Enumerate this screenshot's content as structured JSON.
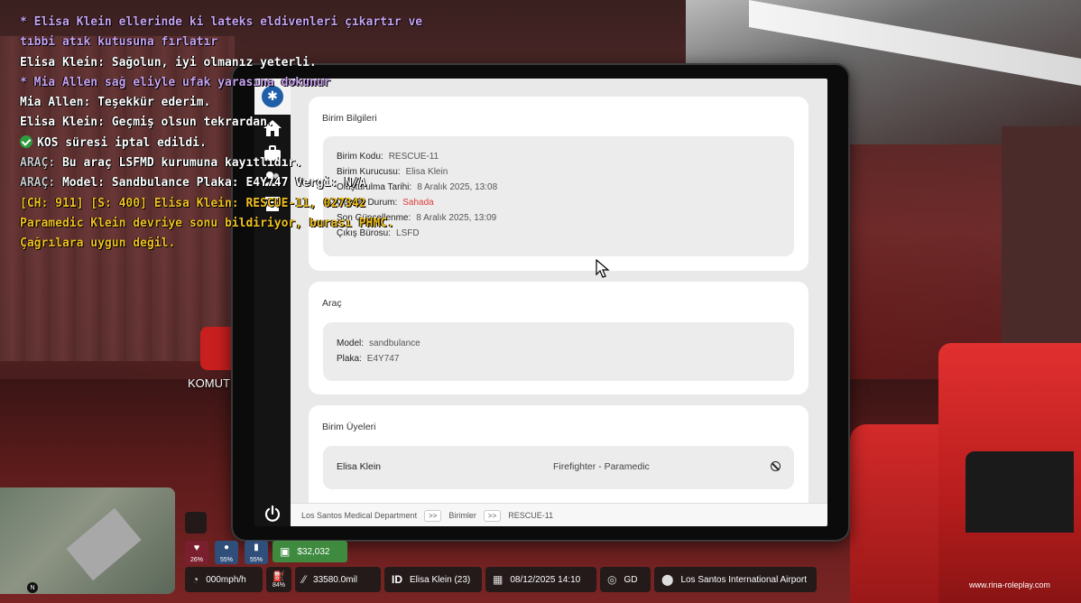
{
  "chat": [
    {
      "type": "me",
      "text": "* Elisa Klein ellerinde ki lateks eldivenleri çıkartır ve tıbbi atık kutusuna fırlatır"
    },
    {
      "type": "say",
      "text": "Elisa Klein: Sağolun, iyi olmanız yeterli."
    },
    {
      "type": "me",
      "text": "* Mia Allen sağ eliyle ufak yarasına dokunur"
    },
    {
      "type": "say",
      "text": "Mia Allen: Teşekkür ederim."
    },
    {
      "type": "say",
      "text": "Elisa Klein: Geçmiş olsun tekrardan."
    },
    {
      "type": "check",
      "text": "KOS süresi iptal edildi."
    },
    {
      "type": "ann",
      "prefix": "ARAÇ:",
      "text": " Bu araç LSFMD kurumuna kayıtlıdır."
    },
    {
      "type": "ann",
      "prefix": "ARAÇ:",
      "text": " Model: Sandbulance Plaka: E4Y747 Vergi: N/A"
    },
    {
      "type": "radio",
      "text": "[CH: 911] [S: 400] Elisa Klein: RESCUE-11, 027342 Paramedic Klein devriye sonu bildiriyor, burası PHMC. Çağrılara uygun değil."
    }
  ],
  "background_label": "KOMUT",
  "tablet": {
    "unit_info": {
      "title": "Birim Bilgileri",
      "rows": [
        {
          "key": "Birim Kodu:",
          "value": "RESCUE-11"
        },
        {
          "key": "Birim Kurucusu:",
          "value": "Elisa Klein"
        },
        {
          "key": "Oluşturulma Tarihi:",
          "value": "8 Aralık 2025, 13:08"
        },
        {
          "key": "Güncel Durum:",
          "value": "Sahada"
        },
        {
          "key": "Son Güncellenme:",
          "value": "8 Aralık 2025, 13:09"
        },
        {
          "key": "Çıkış Bürosu:",
          "value": "LSFD"
        }
      ]
    },
    "vehicle": {
      "title": "Araç",
      "rows": [
        {
          "key": "Model:",
          "value": "sandbulance"
        },
        {
          "key": "Plaka:",
          "value": "E4Y747"
        }
      ]
    },
    "members": {
      "title": "Birim Üyeleri",
      "rows": [
        {
          "name": "Elisa Klein",
          "role": "Firefighter - Paramedic"
        }
      ]
    },
    "breadcrumb": [
      "Los Santos Medical Department",
      "Birimler",
      "RESCUE-11"
    ],
    "breadcrumb_sep": ">>",
    "logo": "star-of-life-logo"
  },
  "hud": {
    "health": "26%",
    "hunger": "55%",
    "thirst": "55%",
    "cash": "$32,032",
    "speed": "000mph/h",
    "fuel": "84%",
    "odometer": "33580.0mil",
    "id_label": "ID",
    "player": "Elisa Klein (23)",
    "datetime": "08/12/2025 14:10",
    "direction": "GD",
    "location": "Los Santos International Airport",
    "north": "N",
    "watermark": "www.rina-roleplay.com"
  }
}
